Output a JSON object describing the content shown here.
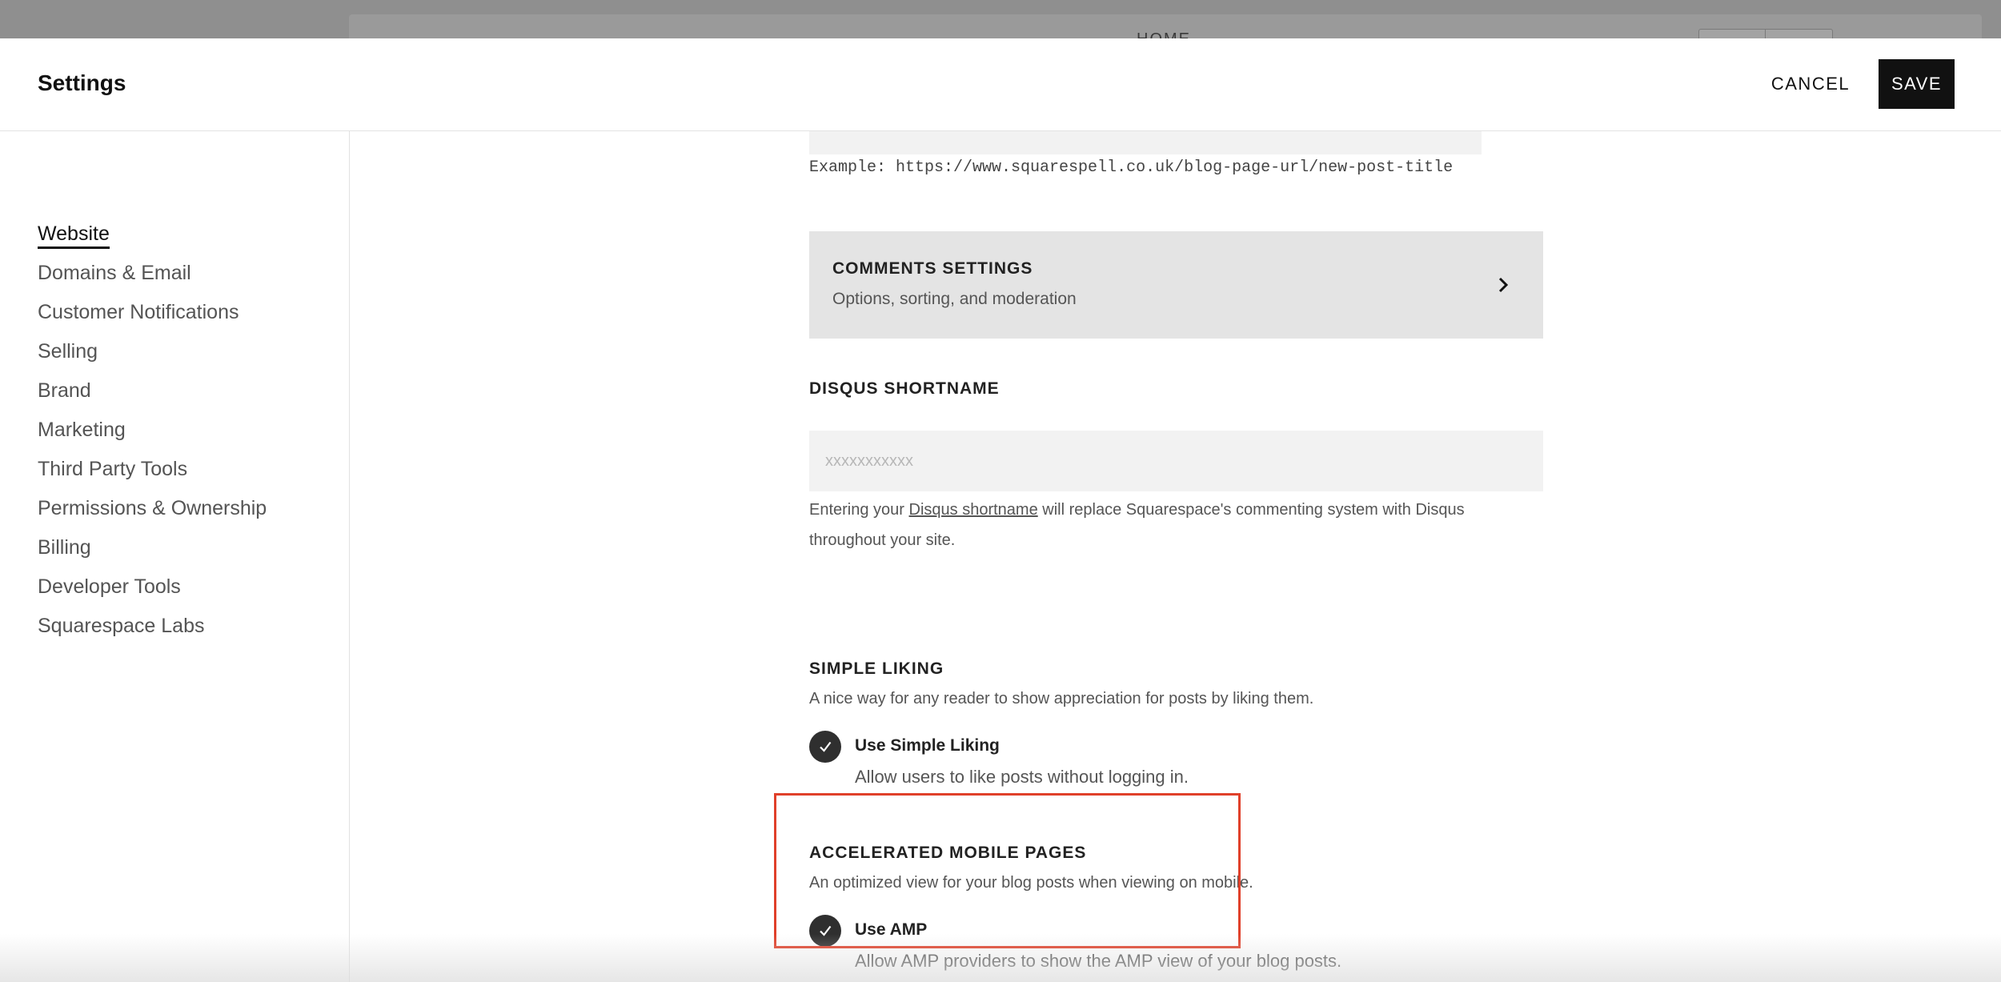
{
  "background": {
    "editor_label": "HOME"
  },
  "header": {
    "title": "Settings",
    "cancel_label": "CANCEL",
    "save_label": "SAVE"
  },
  "sidebar": {
    "items": [
      {
        "label": "Website",
        "active": true
      },
      {
        "label": "Domains & Email"
      },
      {
        "label": "Customer Notifications"
      },
      {
        "label": "Selling"
      },
      {
        "label": "Brand"
      },
      {
        "label": "Marketing"
      },
      {
        "label": "Third Party Tools"
      },
      {
        "label": "Permissions & Ownership"
      },
      {
        "label": "Billing"
      },
      {
        "label": "Developer Tools"
      },
      {
        "label": "Squarespace Labs"
      }
    ]
  },
  "main": {
    "url_example": "Example: https://www.squarespell.co.uk/blog-page-url/new-post-title",
    "comments": {
      "title": "COMMENTS SETTINGS",
      "subtitle": "Options, sorting, and moderation",
      "icon": "chevron-right-icon"
    },
    "disqus": {
      "label": "DISQUS SHORTNAME",
      "placeholder": "xxxxxxxxxxx",
      "value": "",
      "help_prefix": "Entering your ",
      "help_link": "Disqus shortname",
      "help_suffix": " will replace Squarespace's commenting system with Disqus throughout your site."
    },
    "simple_liking": {
      "label": "SIMPLE LIKING",
      "description": "A nice way for any reader to show appreciation for posts by liking them.",
      "option_label": "Use Simple Liking",
      "option_desc": "Allow users to like posts without logging in.",
      "checked": true
    },
    "amp": {
      "label": "ACCELERATED MOBILE PAGES",
      "description": "An optimized view for your blog posts when viewing on mobile.",
      "option_label": "Use AMP",
      "option_desc": "Allow AMP providers to show the AMP view of your blog posts.",
      "checked": true
    }
  },
  "colors": {
    "highlight": "#e0402a",
    "save_bg": "#111111",
    "check_bg": "#2f2f2f"
  }
}
